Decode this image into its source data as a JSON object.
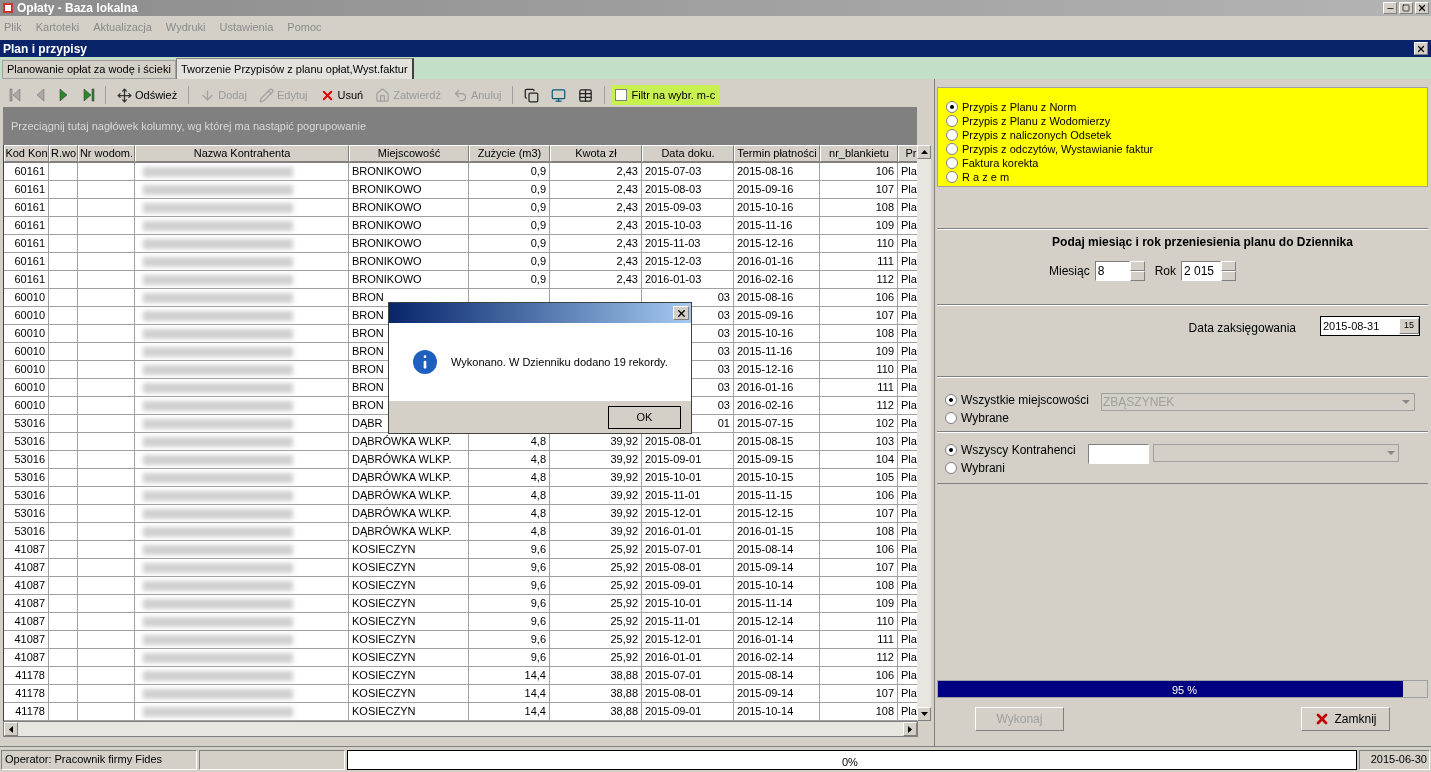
{
  "window": {
    "title": "Opłaty - Baza lokalna"
  },
  "menu": [
    {
      "label": "Plik",
      "disabled": true
    },
    {
      "label": "Kartoteki",
      "disabled": true
    },
    {
      "label": "Aktualizacja",
      "disabled": true
    },
    {
      "label": "Wydruki",
      "disabled": true
    },
    {
      "label": "Ustawienia",
      "disabled": true
    },
    {
      "label": "Pomoc",
      "disabled": true
    }
  ],
  "child_window": {
    "title": "Plan i przypisy"
  },
  "tabs": [
    {
      "label": "Planowanie opłat za wodę i ścieki",
      "selected": false
    },
    {
      "label": "Tworzenie Przypisów z planu opłat,Wyst.faktur",
      "selected": true
    }
  ],
  "toolbar": [
    {
      "kind": "first",
      "disabled": true
    },
    {
      "kind": "prev",
      "disabled": true
    },
    {
      "kind": "next",
      "disabled": false
    },
    {
      "kind": "last",
      "disabled": false
    },
    {
      "kind": "refresh",
      "label": "Odśwież",
      "disabled": false
    },
    {
      "kind": "add",
      "label": "Dodaj",
      "disabled": true
    },
    {
      "kind": "edit",
      "label": "Edytuj",
      "disabled": true
    },
    {
      "kind": "delete",
      "label": "Usuń",
      "disabled": false
    },
    {
      "kind": "confirm",
      "label": "Zatwierdź",
      "disabled": true
    },
    {
      "kind": "cancel",
      "label": "Anuluj",
      "disabled": true
    },
    {
      "kind": "copy",
      "disabled": false
    },
    {
      "kind": "screen",
      "disabled": false
    },
    {
      "kind": "grid",
      "disabled": false
    }
  ],
  "filter": {
    "label": "Filtr na wybr. m-c",
    "checked": false
  },
  "group_hint": "Przeciągnij tutaj nagłówek kolumny, wg której ma nastąpić pogrupowanie",
  "table": {
    "columns": [
      "Kod Kon",
      "R.wo",
      "Nr wodom.",
      "Nazwa Kontrahenta",
      "Miejscowość",
      "Zużycie (m3)",
      "Kwota zł",
      "Data doku.",
      "Termin płatności",
      "nr_blankietu",
      "Pr"
    ],
    "rows": [
      {
        "kod_kon": "60161",
        "miejscowosc": "BRONIKOWO",
        "zuzycie": "0,9",
        "kwota": "2,43",
        "data_doku": "2015-07-03",
        "termin": "2015-08-16",
        "nr_blankietu": "106",
        "column_11": "Pla",
        "covered": false
      },
      {
        "kod_kon": "60161",
        "miejscowosc": "BRONIKOWO",
        "zuzycie": "0,9",
        "kwota": "2,43",
        "data_doku": "2015-08-03",
        "termin": "2015-09-16",
        "nr_blankietu": "107",
        "column_11": "Pla",
        "covered": false
      },
      {
        "kod_kon": "60161",
        "miejscowosc": "BRONIKOWO",
        "zuzycie": "0,9",
        "kwota": "2,43",
        "data_doku": "2015-09-03",
        "termin": "2015-10-16",
        "nr_blankietu": "108",
        "column_11": "Pla",
        "covered": false
      },
      {
        "kod_kon": "60161",
        "miejscowosc": "BRONIKOWO",
        "zuzycie": "0,9",
        "kwota": "2,43",
        "data_doku": "2015-10-03",
        "termin": "2015-11-16",
        "nr_blankietu": "109",
        "column_11": "Pla",
        "covered": false
      },
      {
        "kod_kon": "60161",
        "miejscowosc": "BRONIKOWO",
        "zuzycie": "0,9",
        "kwota": "2,43",
        "data_doku": "2015-11-03",
        "termin": "2015-12-16",
        "nr_blankietu": "110",
        "column_11": "Pla",
        "covered": false
      },
      {
        "kod_kon": "60161",
        "miejscowosc": "BRONIKOWO",
        "zuzycie": "0,9",
        "kwota": "2,43",
        "data_doku": "2015-12-03",
        "termin": "2016-01-16",
        "nr_blankietu": "111",
        "column_11": "Pla",
        "covered": false
      },
      {
        "kod_kon": "60161",
        "miejscowosc": "BRONIKOWO",
        "zuzycie": "0,9",
        "kwota": "2,43",
        "data_doku": "2016-01-03",
        "termin": "2016-02-16",
        "nr_blankietu": "112",
        "column_11": "Pla",
        "covered": false
      },
      {
        "kod_kon": "60010",
        "miejscowosc": "BRON",
        "data_doku": "03",
        "termin": "2015-08-16",
        "nr_blankietu": "106",
        "column_11": "Pla",
        "covered": true
      },
      {
        "kod_kon": "60010",
        "miejscowosc": "BRON",
        "data_doku": "03",
        "termin": "2015-09-16",
        "nr_blankietu": "107",
        "column_11": "Pla",
        "covered": true
      },
      {
        "kod_kon": "60010",
        "miejscowosc": "BRON",
        "data_doku": "03",
        "termin": "2015-10-16",
        "nr_blankietu": "108",
        "column_11": "Pla",
        "covered": true
      },
      {
        "kod_kon": "60010",
        "miejscowosc": "BRON",
        "data_doku": "03",
        "termin": "2015-11-16",
        "nr_blankietu": "109",
        "column_11": "Pla",
        "covered": true
      },
      {
        "kod_kon": "60010",
        "miejscowosc": "BRON",
        "data_doku": "03",
        "termin": "2015-12-16",
        "nr_blankietu": "110",
        "column_11": "Pla",
        "covered": true
      },
      {
        "kod_kon": "60010",
        "miejscowosc": "BRON",
        "data_doku": "03",
        "termin": "2016-01-16",
        "nr_blankietu": "111",
        "column_11": "Pla",
        "covered": true
      },
      {
        "kod_kon": "60010",
        "miejscowosc": "BRON",
        "data_doku": "03",
        "termin": "2016-02-16",
        "nr_blankietu": "112",
        "column_11": "Pla",
        "covered": true
      },
      {
        "kod_kon": "53016",
        "miejscowosc": "DĄBR",
        "data_doku": "01",
        "termin": "2015-07-15",
        "nr_blankietu": "102",
        "column_11": "Pla",
        "covered": true
      },
      {
        "kod_kon": "53016",
        "miejscowosc": "DĄBRÓWKA WLKP.",
        "zuzycie": "4,8",
        "kwota": "39,92",
        "data_doku": "2015-08-01",
        "termin": "2015-08-15",
        "nr_blankietu": "103",
        "column_11": "Pla",
        "covered": false
      },
      {
        "kod_kon": "53016",
        "miejscowosc": "DĄBRÓWKA WLKP.",
        "zuzycie": "4,8",
        "kwota": "39,92",
        "data_doku": "2015-09-01",
        "termin": "2015-09-15",
        "nr_blankietu": "104",
        "column_11": "Pla",
        "covered": false
      },
      {
        "kod_kon": "53016",
        "miejscowosc": "DĄBRÓWKA WLKP.",
        "zuzycie": "4,8",
        "kwota": "39,92",
        "data_doku": "2015-10-01",
        "termin": "2015-10-15",
        "nr_blankietu": "105",
        "column_11": "Pla",
        "covered": false
      },
      {
        "kod_kon": "53016",
        "miejscowosc": "DĄBRÓWKA WLKP.",
        "zuzycie": "4,8",
        "kwota": "39,92",
        "data_doku": "2015-11-01",
        "termin": "2015-11-15",
        "nr_blankietu": "106",
        "column_11": "Pla",
        "covered": false
      },
      {
        "kod_kon": "53016",
        "miejscowosc": "DĄBRÓWKA WLKP.",
        "zuzycie": "4,8",
        "kwota": "39,92",
        "data_doku": "2015-12-01",
        "termin": "2015-12-15",
        "nr_blankietu": "107",
        "column_11": "Pla",
        "covered": false
      },
      {
        "kod_kon": "53016",
        "miejscowosc": "DĄBRÓWKA WLKP.",
        "zuzycie": "4,8",
        "kwota": "39,92",
        "data_doku": "2016-01-01",
        "termin": "2016-01-15",
        "nr_blankietu": "108",
        "column_11": "Pla",
        "covered": false
      },
      {
        "kod_kon": "41087",
        "miejscowosc": "KOSIECZYN",
        "zuzycie": "9,6",
        "kwota": "25,92",
        "data_doku": "2015-07-01",
        "termin": "2015-08-14",
        "nr_blankietu": "106",
        "column_11": "Pla",
        "covered": false
      },
      {
        "kod_kon": "41087",
        "miejscowosc": "KOSIECZYN",
        "zuzycie": "9,6",
        "kwota": "25,92",
        "data_doku": "2015-08-01",
        "termin": "2015-09-14",
        "nr_blankietu": "107",
        "column_11": "Pla",
        "covered": false
      },
      {
        "kod_kon": "41087",
        "miejscowosc": "KOSIECZYN",
        "zuzycie": "9,6",
        "kwota": "25,92",
        "data_doku": "2015-09-01",
        "termin": "2015-10-14",
        "nr_blankietu": "108",
        "column_11": "Pla",
        "covered": false
      },
      {
        "kod_kon": "41087",
        "miejscowosc": "KOSIECZYN",
        "zuzycie": "9,6",
        "kwota": "25,92",
        "data_doku": "2015-10-01",
        "termin": "2015-11-14",
        "nr_blankietu": "109",
        "column_11": "Pla",
        "covered": false
      },
      {
        "kod_kon": "41087",
        "miejscowosc": "KOSIECZYN",
        "zuzycie": "9,6",
        "kwota": "25,92",
        "data_doku": "2015-11-01",
        "termin": "2015-12-14",
        "nr_blankietu": "110",
        "column_11": "Pla",
        "covered": false
      },
      {
        "kod_kon": "41087",
        "miejscowosc": "KOSIECZYN",
        "zuzycie": "9,6",
        "kwota": "25,92",
        "data_doku": "2015-12-01",
        "termin": "2016-01-14",
        "nr_blankietu": "111",
        "column_11": "Pla",
        "covered": false
      },
      {
        "kod_kon": "41087",
        "miejscowosc": "KOSIECZYN",
        "zuzycie": "9,6",
        "kwota": "25,92",
        "data_doku": "2016-01-01",
        "termin": "2016-02-14",
        "nr_blankietu": "112",
        "column_11": "Pla",
        "covered": false
      },
      {
        "kod_kon": "41178",
        "miejscowosc": "KOSIECZYN",
        "zuzycie": "14,4",
        "kwota": "38,88",
        "data_doku": "2015-07-01",
        "termin": "2015-08-14",
        "nr_blankietu": "106",
        "column_11": "Pla",
        "covered": false
      },
      {
        "kod_kon": "41178",
        "miejscowosc": "KOSIECZYN",
        "zuzycie": "14,4",
        "kwota": "38,88",
        "data_doku": "2015-08-01",
        "termin": "2015-09-14",
        "nr_blankietu": "107",
        "column_11": "Pla",
        "covered": false
      },
      {
        "kod_kon": "41178",
        "miejscowosc": "KOSIECZYN",
        "zuzycie": "14,4",
        "kwota": "38,88",
        "data_doku": "2015-09-01",
        "termin": "2015-10-14",
        "nr_blankietu": "108",
        "column_11": "Pla",
        "covered": false
      }
    ]
  },
  "dialog": {
    "message": "Wykonano. W Dzienniku dodano 19 rekordy.",
    "ok": "OK"
  },
  "source_options": [
    {
      "label": "Przypis z Planu z Norm",
      "selected": true
    },
    {
      "label": "Przypis z Planu z Wodomierzy",
      "selected": false
    },
    {
      "label": "Przypis z naliczonych Odsetek",
      "selected": false
    },
    {
      "label": "Przypis z odczytów, Wystawianie faktur",
      "selected": false
    },
    {
      "label": "Faktura korekta",
      "selected": false
    },
    {
      "label": "R a z e m",
      "selected": false
    }
  ],
  "period": {
    "heading": "Podaj miesiąc i rok przeniesienia planu do Dziennika",
    "month_label": "Miesiąc",
    "month": "8",
    "year_label": "Rok",
    "year": "2 015"
  },
  "posting_date": {
    "label": "Data zaksięgowania",
    "value": "2015-08-31",
    "calendar_label": "15"
  },
  "places": {
    "options": [
      {
        "label": "Wszystkie miejscowości",
        "selected": true
      },
      {
        "label": "Wybrane",
        "selected": false
      }
    ],
    "dropdown": "ZBĄSZYNEK",
    "dropdown_disabled": true
  },
  "contractors": {
    "options": [
      {
        "label": "Wszyscy Kontrahenci",
        "selected": true
      },
      {
        "label": "Wybrani",
        "selected": false
      }
    ]
  },
  "progress": {
    "level": 0.95,
    "label": "95 %"
  },
  "buttons": [
    {
      "kind": "run",
      "label": "Wykonaj",
      "disabled": true
    },
    {
      "kind": "close",
      "label": "Zamknij",
      "disabled": false
    }
  ],
  "status_bar": {
    "operator": "Operator: Pracownik firmy Fides",
    "progress": {
      "level": 0,
      "label": "0%"
    },
    "date": "2015-06-30"
  }
}
